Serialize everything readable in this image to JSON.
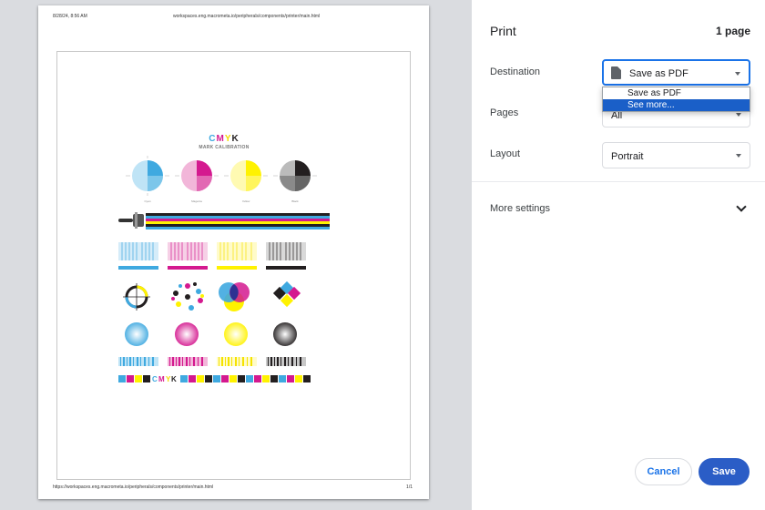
{
  "preview": {
    "header_date": "8/28/24, 8:56 AM",
    "header_url": "workspaces.eng.macrometa.io/peripherals/components/printer/main.html",
    "footer_url": "https://workspaces.eng.macrometa.io/peripherals/components/printer/main.html",
    "footer_page": "1/1",
    "calibration": {
      "title_letters": [
        "C",
        "M",
        "Y",
        "K"
      ],
      "subtitle": "MARK CALIBRATION",
      "bottom_strip_letters": [
        "C",
        "M",
        "Y",
        "K"
      ],
      "swatch_labels": [
        "Cyan",
        "Magenta",
        "Yellow",
        "Black"
      ],
      "ink_colors": {
        "cyan": "#3fa9e0",
        "magenta": "#d4198f",
        "yellow": "#fff200",
        "black": "#231f20"
      }
    }
  },
  "panel": {
    "title": "Print",
    "sheet_count": "1 page",
    "destination": {
      "label": "Destination",
      "value": "Save as PDF",
      "icon": "document-icon",
      "options": [
        "Save as PDF",
        "See more..."
      ],
      "highlighted_option": "See more..."
    },
    "pages": {
      "label": "Pages",
      "value": "All"
    },
    "layout": {
      "label": "Layout",
      "value": "Portrait"
    },
    "more_settings": "More settings",
    "cancel_label": "Cancel",
    "save_label": "Save",
    "accent_color": "#1a73e8",
    "save_button_color": "#2b5dc6",
    "selection_color": "#1a5fc8"
  }
}
